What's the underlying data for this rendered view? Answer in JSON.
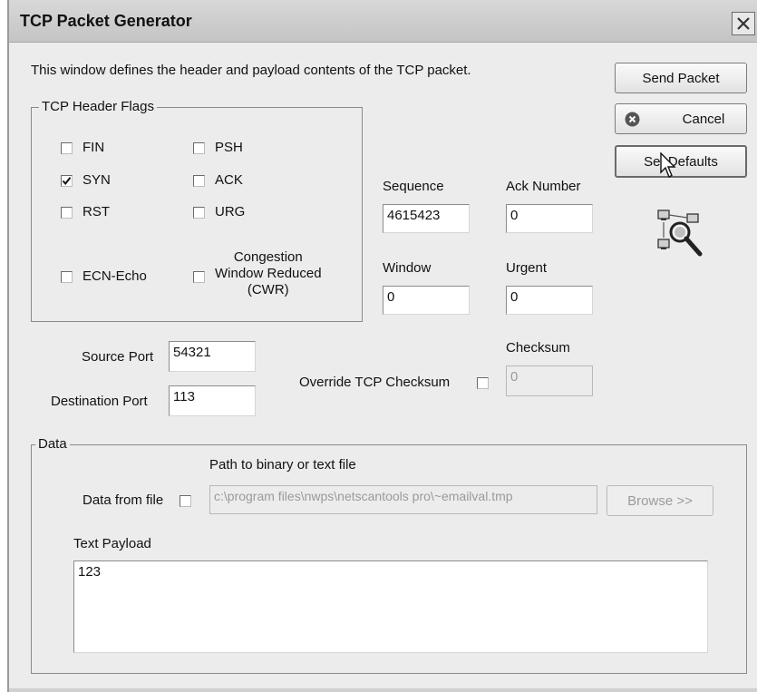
{
  "window": {
    "title": "TCP Packet Generator",
    "close_label": "X"
  },
  "description": "This window defines the header and payload contents of the TCP packet.",
  "flags": {
    "group_label": "TCP Header Flags",
    "fin": {
      "label": "FIN",
      "checked": false
    },
    "psh": {
      "label": "PSH",
      "checked": false
    },
    "syn": {
      "label": "SYN",
      "checked": true
    },
    "ack": {
      "label": "ACK",
      "checked": false
    },
    "rst": {
      "label": "RST",
      "checked": false
    },
    "urg": {
      "label": "URG",
      "checked": false
    },
    "ecn": {
      "label": "ECN-Echo",
      "checked": false
    },
    "cwr": {
      "line1": "Congestion",
      "line2": "Window Reduced",
      "line3": "(CWR)",
      "checked": false
    }
  },
  "fields": {
    "sequence": {
      "label": "Sequence",
      "value": "4615423"
    },
    "ack_number": {
      "label": "Ack Number",
      "value": "0"
    },
    "window": {
      "label": "Window",
      "value": "0"
    },
    "urgent": {
      "label": "Urgent",
      "value": "0"
    },
    "checksum": {
      "label": "Checksum",
      "value": "0"
    },
    "override_checksum": {
      "label": "Override TCP Checksum",
      "checked": false
    },
    "source_port": {
      "label": "Source Port",
      "value": "54321"
    },
    "destination_port": {
      "label": "Destination Port",
      "value": "113"
    }
  },
  "buttons": {
    "send_packet": "Send Packet",
    "cancel": "Cancel",
    "set_defaults": "Set Defaults",
    "browse": "Browse >>"
  },
  "data_group": {
    "label": "Data",
    "path_label": "Path to binary or text file",
    "data_from_file_label": "Data from file",
    "data_from_file_checked": false,
    "path_value": "c:\\program files\\nwps\\netscantools pro\\~emailval.tmp",
    "text_payload_label": "Text Payload",
    "text_payload_value": "123"
  },
  "icons": {
    "cancel": "cancel-x-circle-icon",
    "network_search": "network-search-icon",
    "cursor": "mouse-pointer-icon"
  }
}
